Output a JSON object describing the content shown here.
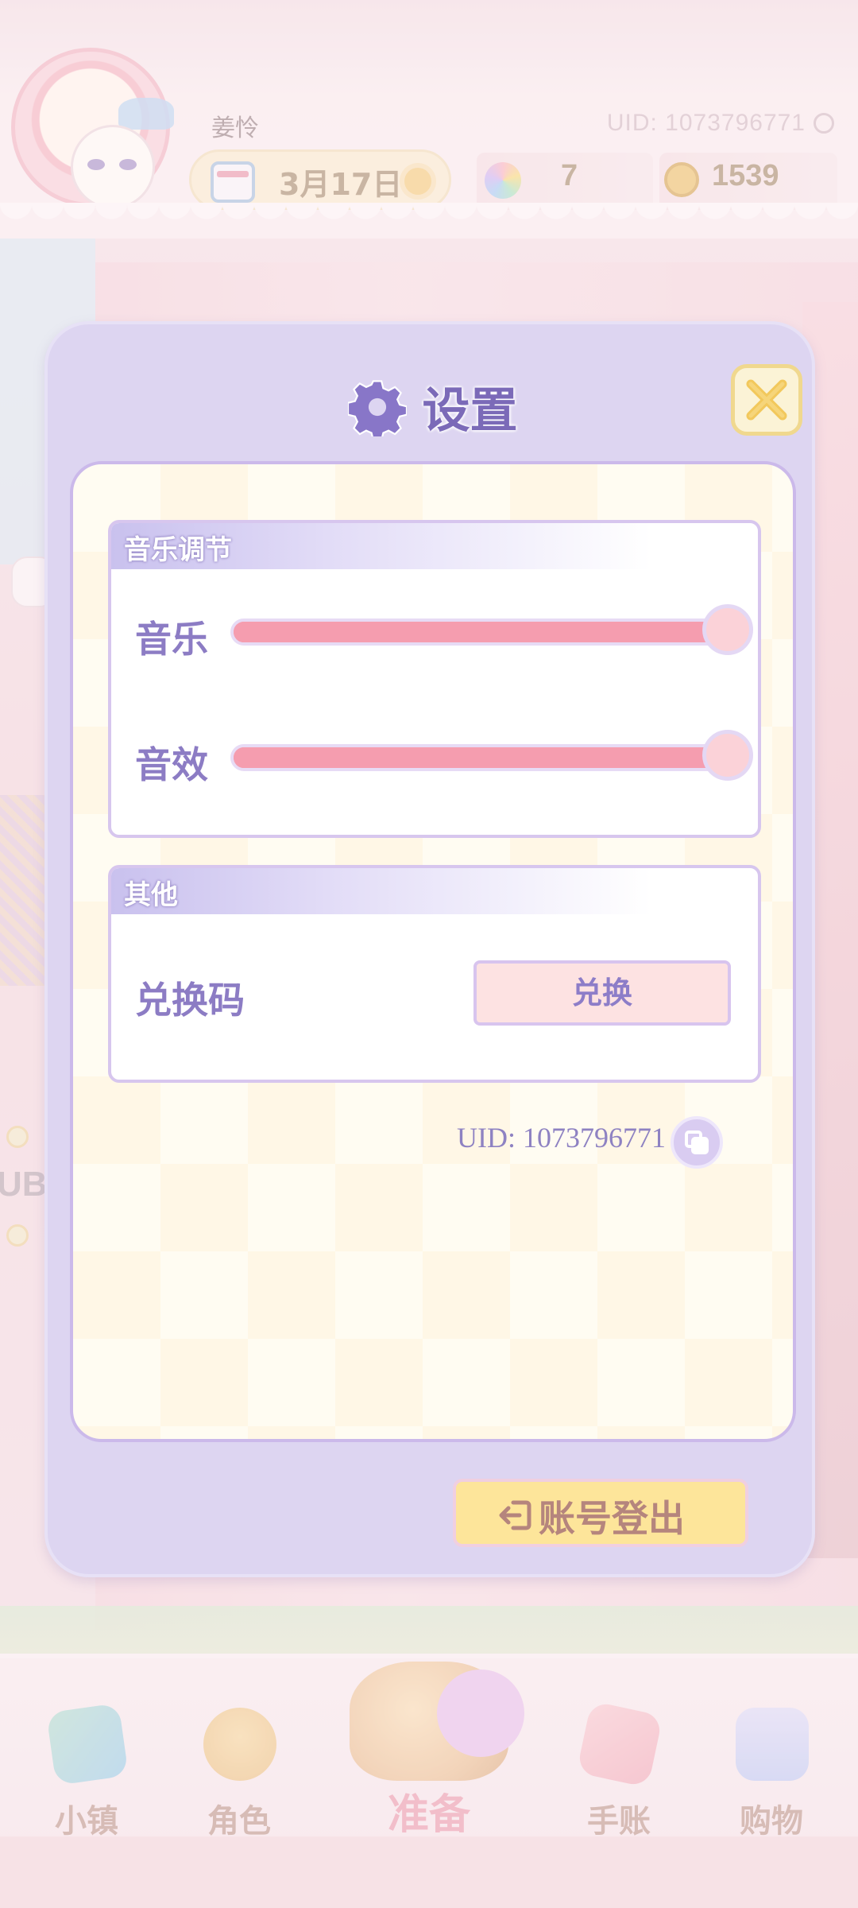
{
  "hud": {
    "username": "姜怜",
    "uid_label": "UID: 1073796771",
    "date": "3月17日",
    "flowers": "7",
    "coins": "1539"
  },
  "bottom_nav": {
    "items": [
      {
        "label": "小镇",
        "icon": "map-icon"
      },
      {
        "label": "角色",
        "icon": "character-icon"
      },
      {
        "label": "准备",
        "icon": "basket-icon"
      },
      {
        "label": "手账",
        "icon": "journal-icon"
      },
      {
        "label": "购物",
        "icon": "shopping-bag-icon"
      }
    ]
  },
  "background": {
    "partial_text": "UB"
  },
  "dialog": {
    "title": "设置",
    "close_icon": "close-icon",
    "sections": {
      "music": {
        "header": "音乐调节",
        "music_label": "音乐",
        "sfx_label": "音效",
        "music_level": 1.0,
        "sfx_level": 1.0
      },
      "other": {
        "header": "其他",
        "redeem_label": "兑换码",
        "redeem_button": "兑换"
      }
    },
    "uid_text": "UID: 1073796771",
    "logout_button": "账号登出"
  },
  "colors": {
    "dialog_bg": "#ddd5f1",
    "slider": "#f59daf",
    "accent_purple": "#8c7cc4",
    "logout_bg": "#fde59a"
  }
}
